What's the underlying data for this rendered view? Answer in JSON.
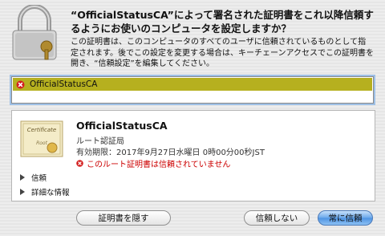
{
  "dialog": {
    "title": "“OfficialStatusCA”によって署名された証明書をこれ以降信頼するようにお使いのコンピュータを設定しますか？",
    "description": "この証明書は、このコンピュータのすべてのユーザに信頼されているものとして指定されます。後でこの設定を変更する場合は、キーチェーンアクセスでこの証明書を開き、“信頼設定”を編集してください。"
  },
  "cert_list": {
    "items": [
      {
        "label": "OfficialStatusCA",
        "icon": "cert-error-icon"
      }
    ]
  },
  "cert_detail": {
    "name": "OfficialStatusCA",
    "type": "ルート認証局",
    "expires": "有効期限：2017年9月27日水曜日 0時00分00秒JST",
    "error": "このルート証明書は信頼されていません",
    "image_text_top": "Certificate",
    "image_text_bottom": "Root",
    "disclosures": [
      {
        "label": "信頼"
      },
      {
        "label": "詳細な情報"
      }
    ]
  },
  "buttons": {
    "hide_cert": "証明書を隠す",
    "dont_trust": "信頼しない",
    "always_trust": "常に信頼"
  },
  "colors": {
    "selection": "#b6b01f",
    "error": "#cc0000",
    "default_button": "#4d93e3"
  }
}
